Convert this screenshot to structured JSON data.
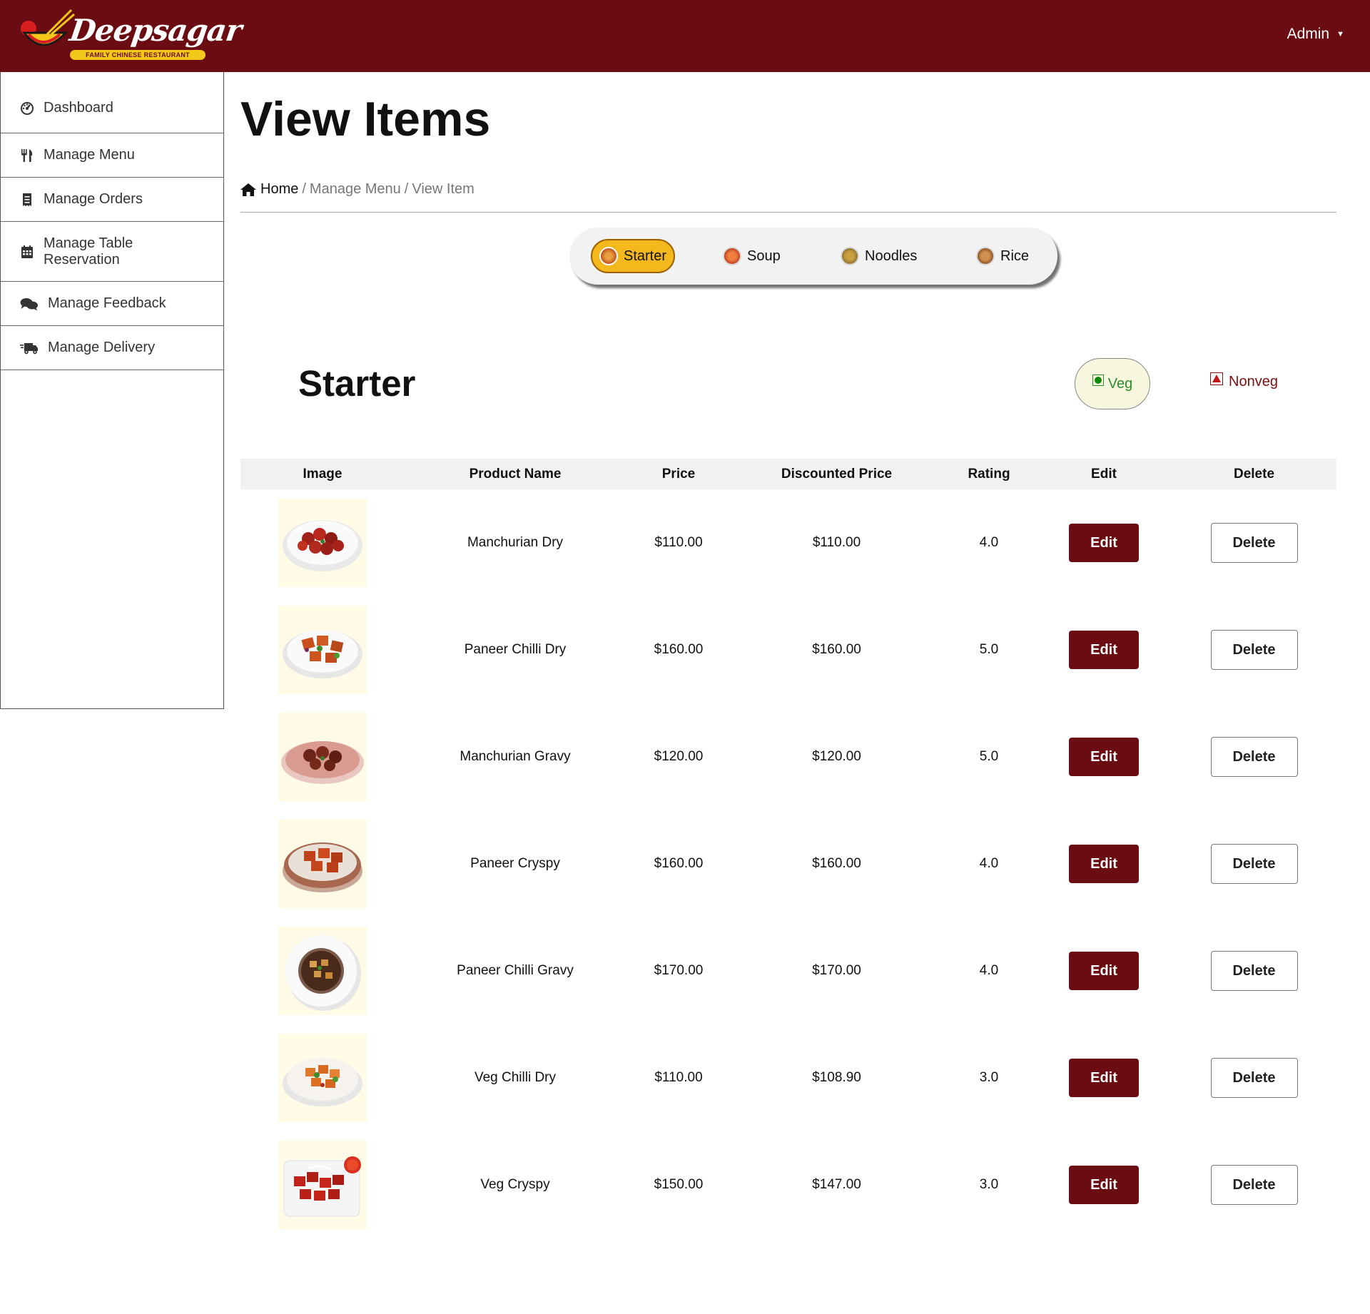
{
  "header": {
    "logo_text": "Deepsagar",
    "logo_tagline": "FAMILY CHINESE RESTAURANT",
    "user_menu_label": "Admin",
    "caret": "▼",
    "brand_color": "#6b0c12"
  },
  "sidebar": {
    "items": [
      {
        "label": "Dashboard",
        "icon": "dashboard-gauge-icon"
      },
      {
        "label": "Manage Menu",
        "icon": "utensils-icon"
      },
      {
        "label": "Manage Orders",
        "icon": "receipt-icon"
      },
      {
        "label": "Manage Table Reservation",
        "icon": "calendar-icon"
      },
      {
        "label": "Manage Feedback",
        "icon": "comments-icon"
      },
      {
        "label": "Manage Delivery",
        "icon": "delivery-truck-icon"
      }
    ]
  },
  "main": {
    "title": "View Items",
    "breadcrumb": {
      "home": "Home",
      "sep": "/",
      "level1": "Manage Menu",
      "level2": "View Item"
    },
    "categories": [
      {
        "label": "Starter",
        "active": true
      },
      {
        "label": "Soup",
        "active": false
      },
      {
        "label": "Noodles",
        "active": false
      },
      {
        "label": "Rice",
        "active": false
      }
    ],
    "section_title": "Starter",
    "filters": {
      "veg": "Veg",
      "nonveg": "Nonveg"
    },
    "table": {
      "headers": [
        "Image",
        "Product Name",
        "Price",
        "Discounted Price",
        "Rating",
        "Edit",
        "Delete"
      ],
      "edit_label": "Edit",
      "delete_label": "Delete",
      "rows": [
        {
          "name": "Manchurian Dry",
          "price": "$110.00",
          "discounted": "$110.00",
          "rating": "4.0"
        },
        {
          "name": "Paneer Chilli Dry",
          "price": "$160.00",
          "discounted": "$160.00",
          "rating": "5.0"
        },
        {
          "name": "Manchurian Gravy",
          "price": "$120.00",
          "discounted": "$120.00",
          "rating": "5.0"
        },
        {
          "name": "Paneer Cryspy",
          "price": "$160.00",
          "discounted": "$160.00",
          "rating": "4.0"
        },
        {
          "name": "Paneer Chilli Gravy",
          "price": "$170.00",
          "discounted": "$170.00",
          "rating": "4.0"
        },
        {
          "name": "Veg Chilli Dry",
          "price": "$110.00",
          "discounted": "$108.90",
          "rating": "3.0"
        },
        {
          "name": "Veg Cryspy",
          "price": "$150.00",
          "discounted": "$147.00",
          "rating": "3.0"
        }
      ]
    }
  }
}
